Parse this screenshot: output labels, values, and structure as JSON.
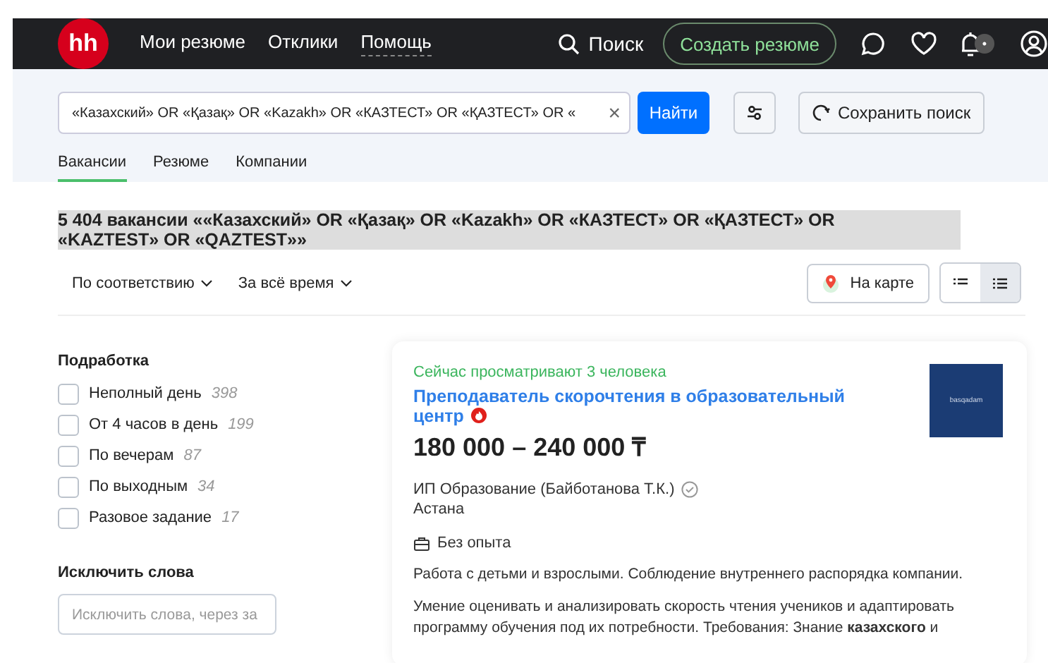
{
  "header": {
    "logo": "hh",
    "nav": [
      {
        "label": "Мои резюме",
        "selected": false
      },
      {
        "label": "Отклики",
        "selected": false
      },
      {
        "label": "Помощь",
        "selected": true
      }
    ],
    "search_link": "Поиск",
    "create_button": "Создать резюме",
    "notifications_badge": "•"
  },
  "search": {
    "value": "«Казахский» OR «Қазақ» OR «Kazakh» OR «КАЗТЕСТ» OR «ҚАЗТЕСТ» OR «",
    "clear": "×",
    "submit": "Найти",
    "save": "Сохранить поиск"
  },
  "tabs": [
    {
      "label": "Вакансии",
      "selected": true
    },
    {
      "label": "Резюме",
      "selected": false
    },
    {
      "label": "Компании",
      "selected": false
    }
  ],
  "results_title": "5 404 вакансии ««Казахский» OR «Қазақ» OR «Kazakh» OR «КАЗТЕСТ» OR «ҚАЗТЕСТ» OR «KAZTEST» OR «QAZTEST»»",
  "sort": [
    "По соответствию",
    "За всё время"
  ],
  "map_button": "На карте",
  "view_modes": [
    {
      "kind": "compact",
      "selected": false
    },
    {
      "kind": "detailed",
      "selected": true
    }
  ],
  "filters": {
    "title": "Подработка",
    "items": [
      {
        "label": "Неполный день",
        "count": "398",
        "checked": false
      },
      {
        "label": "От 4 часов в день",
        "count": "199",
        "checked": false
      },
      {
        "label": "По вечерам",
        "count": "87",
        "checked": false
      },
      {
        "label": "По выходным",
        "count": "34",
        "checked": false
      },
      {
        "label": "Разовое задание",
        "count": "17",
        "checked": false
      }
    ]
  },
  "exclude": {
    "title": "Исключить слова",
    "placeholder": "Исключить слова, через за"
  },
  "vacancy": {
    "viewers": "Сейчас просматривают 3 человека",
    "title": "Преподаватель скорочтения в образовательный центр",
    "hot": true,
    "salary": "180 000 – 240 000 ₸",
    "company": "ИП Образование (Байботанова Т.К.)",
    "verified": true,
    "city": "Астана",
    "experience": "Без опыта",
    "logo_text": "basqadam",
    "description": [
      "Работа с детьми и взрослыми. Соблюдение внутреннего распорядка компании.",
      "Умение оценивать и анализировать скорость чтения учеников и адаптировать программу обучения под их потребности. Требования: Знание **казахского** и"
    ]
  }
}
